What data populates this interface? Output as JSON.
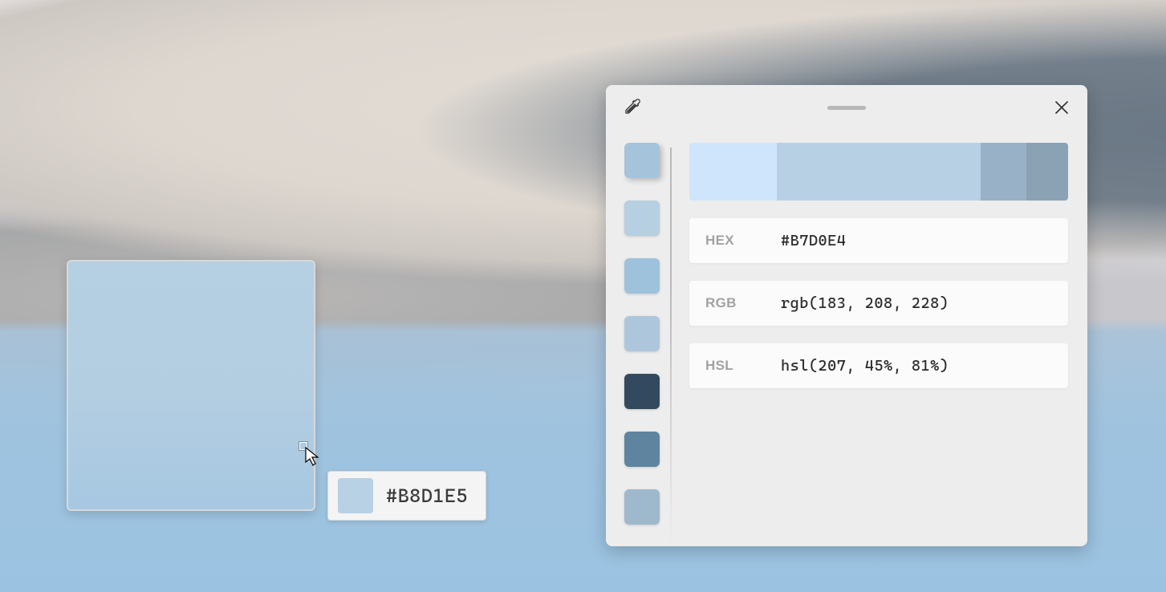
{
  "hover": {
    "hex": "#B8D1E5",
    "swatch_color": "#B8D1E5"
  },
  "panel": {
    "shades": [
      {
        "color": "#cfe5fb",
        "width_pct": 23
      },
      {
        "color": "#b7d0e4",
        "width_pct": 54
      },
      {
        "color": "#98b1c6",
        "width_pct": 12
      },
      {
        "color": "#8ba2b5",
        "width_pct": 11
      }
    ],
    "values": {
      "hex_label": "HEX",
      "hex_value": "#B7D0E4",
      "rgb_label": "RGB",
      "rgb_value": "rgb(183, 208, 228)",
      "hsl_label": "HSL",
      "hsl_value": "hsl(207, 45%, 81%)"
    },
    "history": [
      {
        "color": "#a5c3da",
        "selected": true
      },
      {
        "color": "#b6cfe1",
        "selected": false
      },
      {
        "color": "#9ec1dc",
        "selected": false
      },
      {
        "color": "#aec6dc",
        "selected": false
      },
      {
        "color": "#334a5e",
        "selected": false
      },
      {
        "color": "#5e84a0",
        "selected": false
      },
      {
        "color": "#9fb9cc",
        "selected": false
      }
    ]
  },
  "icons": {
    "eyedropper": "eyedropper-icon",
    "close": "close-icon",
    "grip": "drag-grip",
    "cursor": "cursor-arrow"
  }
}
